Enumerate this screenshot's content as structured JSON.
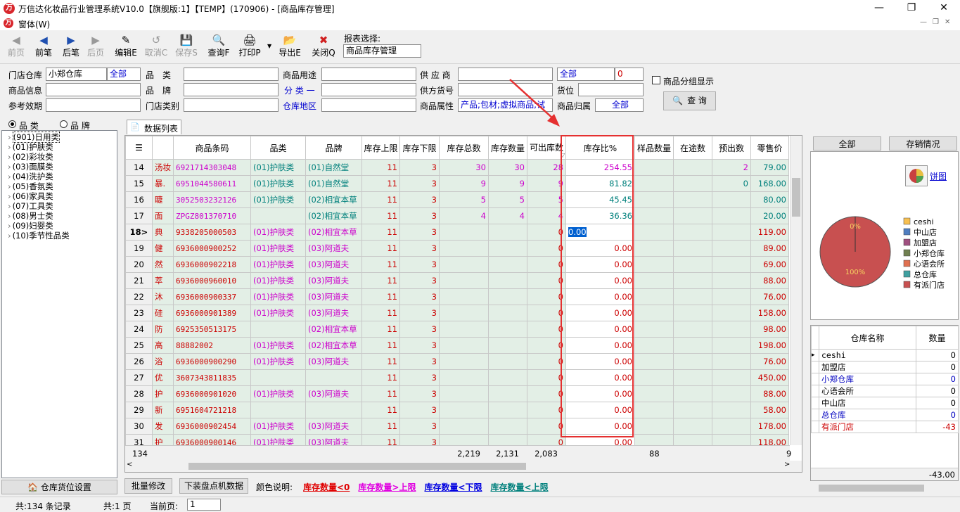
{
  "window": {
    "title": "万信达化妆品行业管理系统V10.0【旗舰版:1】【TEMP】(170906) - [商品库存管理]",
    "menu": "窗体(W)"
  },
  "toolbar": {
    "buttons": [
      {
        "label": "前页",
        "icon": "first-page-icon",
        "enabled": false
      },
      {
        "label": "前笔",
        "icon": "prev-icon",
        "enabled": true
      },
      {
        "label": "后笔",
        "icon": "next-icon",
        "enabled": true
      },
      {
        "label": "后页",
        "icon": "last-page-icon",
        "enabled": false
      },
      {
        "label": "编辑E",
        "icon": "edit-icon",
        "enabled": true
      },
      {
        "label": "取消C",
        "icon": "undo-icon",
        "enabled": false
      },
      {
        "label": "保存S",
        "icon": "save-icon",
        "enabled": false
      },
      {
        "label": "查询F",
        "icon": "query-icon",
        "enabled": true
      },
      {
        "label": "打印P",
        "icon": "print-icon",
        "enabled": true
      },
      {
        "label": "导出E",
        "icon": "export-icon",
        "enabled": true
      },
      {
        "label": "关闭Q",
        "icon": "close-icon",
        "enabled": true
      }
    ],
    "report_label": "报表选择:",
    "report_value": "商品库存管理"
  },
  "filters": {
    "store_label": "门店仓库",
    "store_value": "小郑仓库",
    "store_all": "全部",
    "category_label": "品　类",
    "usage_label": "商品用途",
    "supplier_label": "供 应 商",
    "supplier_all": "全部",
    "supplier_num": "0",
    "group_label": "商品分组显示",
    "goods_info_label": "商品信息",
    "brand_label": "品　牌",
    "class_label": "分 类 一",
    "supplier_code_label": "供方货号",
    "location_label": "货位",
    "expiry_label": "参考效期",
    "store_type_label": "门店类别",
    "area_label": "仓库地区",
    "attr_label": "商品属性",
    "attr_value": "产品;包材;虚拟商品;试",
    "owner_label": "商品归属",
    "owner_value": "全部",
    "query_button": "查 询"
  },
  "tree": {
    "radio1": "品 类",
    "radio2": "品 牌",
    "items": [
      "(901)日用类",
      "(01)护肤类",
      "(02)彩妆类",
      "(03)面膜类",
      "(04)洗护类",
      "(05)香氛类",
      "(06)家具类",
      "(07)工具类",
      "(08)男士类",
      "(09)妇婴类",
      "(10)季节性品类"
    ],
    "bottom_button": "仓库货位设置"
  },
  "grid": {
    "tab": "数据列表",
    "columns": [
      "商品条码",
      "品类",
      "品牌",
      "库存上限",
      "库存下限",
      "库存总数",
      "库存数量",
      "可出库数",
      "库存比%",
      "样品数量",
      "在途数",
      "预出数",
      "零售价"
    ],
    "rows": [
      [
        "14",
        "汤妆",
        "6921714303048",
        "(01)护肤类",
        "(01)自然堂",
        "11",
        "3",
        "30",
        "30",
        "28",
        "254.55",
        "",
        "",
        "2",
        "79.00"
      ],
      [
        "15",
        "暴.",
        "6951044580611",
        "(01)护肤类",
        "(01)自然堂",
        "11",
        "3",
        "9",
        "9",
        "9",
        "81.82",
        "",
        "",
        "0",
        "168.00"
      ],
      [
        "16",
        "睫",
        "3052503232126",
        "(01)护肤类",
        "(02)相宜本草",
        "11",
        "3",
        "5",
        "5",
        "5",
        "45.45",
        "",
        "",
        "",
        "80.00"
      ],
      [
        "17",
        "面",
        "ZPGZ801370710",
        "",
        "(02)相宜本草",
        "11",
        "3",
        "4",
        "4",
        "4",
        "36.36",
        "",
        "",
        "",
        "20.00"
      ],
      [
        "18>",
        "典",
        "9338205000503",
        "(01)护肤类",
        "(02)相宜本草",
        "11",
        "3",
        "",
        "",
        "0",
        "0.00",
        "",
        "",
        "",
        "119.00"
      ],
      [
        "19",
        "健",
        "6936000900252",
        "(01)护肤类",
        "(03)阿道夫",
        "11",
        "3",
        "",
        "",
        "0",
        "0.00",
        "",
        "",
        "",
        "89.00"
      ],
      [
        "20",
        "然",
        "6936000902218",
        "(01)护肤类",
        "(03)阿道夫",
        "11",
        "3",
        "",
        "",
        "0",
        "0.00",
        "",
        "",
        "",
        "69.00"
      ],
      [
        "21",
        "萃",
        "6936000960010",
        "(01)护肤类",
        "(03)阿道夫",
        "11",
        "3",
        "",
        "",
        "0",
        "0.00",
        "",
        "",
        "",
        "88.00"
      ],
      [
        "22",
        "沐",
        "6936000900337",
        "(01)护肤类",
        "(03)阿道夫",
        "11",
        "3",
        "",
        "",
        "0",
        "0.00",
        "",
        "",
        "",
        "76.00"
      ],
      [
        "23",
        "硅",
        "6936000901389",
        "(01)护肤类",
        "(03)阿道夫",
        "11",
        "3",
        "",
        "",
        "0",
        "0.00",
        "",
        "",
        "",
        "158.00"
      ],
      [
        "24",
        "防",
        "6925350513175",
        "",
        "(02)相宜本草",
        "11",
        "3",
        "",
        "",
        "0",
        "0.00",
        "",
        "",
        "",
        "98.00"
      ],
      [
        "25",
        "高",
        "88882002",
        "(01)护肤类",
        "(02)相宜本草",
        "11",
        "3",
        "",
        "",
        "0",
        "0.00",
        "",
        "",
        "",
        "198.00"
      ],
      [
        "26",
        "浴",
        "6936000900290",
        "(01)护肤类",
        "(03)阿道夫",
        "11",
        "3",
        "",
        "",
        "0",
        "0.00",
        "",
        "",
        "",
        "76.00"
      ],
      [
        "27",
        "优",
        "3607343811835",
        "",
        "",
        "11",
        "3",
        "",
        "",
        "0",
        "0.00",
        "",
        "",
        "",
        "450.00"
      ],
      [
        "28",
        "护",
        "6936000901020",
        "(01)护肤类",
        "(03)阿道夫",
        "11",
        "3",
        "",
        "",
        "0",
        "0.00",
        "",
        "",
        "",
        "88.00"
      ],
      [
        "29",
        "新",
        "6951604721218",
        "",
        "",
        "11",
        "3",
        "",
        "",
        "0",
        "0.00",
        "",
        "",
        "",
        "58.00"
      ],
      [
        "30",
        "发",
        "6936000902454",
        "(01)护肤类",
        "(03)阿道夫",
        "11",
        "3",
        "",
        "",
        "0",
        "0.00",
        "",
        "",
        "",
        "178.00"
      ],
      [
        "31",
        "护",
        "6936000900146",
        "(01)护肤类",
        "(03)阿道夫",
        "11",
        "3",
        "",
        "",
        "0",
        "0.00",
        "",
        "",
        "",
        "118.00"
      ]
    ],
    "footer": {
      "count": "134",
      "total": "2,219",
      "qty": "2,131",
      "out": "2,083",
      "sample": "88",
      "tail": "9"
    },
    "edit_cell": "0.00"
  },
  "bottom": {
    "batch_button": "批量修改",
    "download_button": "下装盘点机数据",
    "legend_label": "颜色说明:",
    "legend": [
      {
        "text": "库存数量<0",
        "color": "#e00000"
      },
      {
        "text": "库存数量>上限",
        "color": "#e000e0"
      },
      {
        "text": "库存数量<下限",
        "color": "#0000e0"
      },
      {
        "text": "库存数量<上限",
        "color": "#00807c"
      }
    ]
  },
  "right": {
    "btn_all": "全部",
    "btn_stock": "存销情况",
    "pie_link": "饼图",
    "chart_data": {
      "type": "pie",
      "categories": [
        "ceshi",
        "中山店",
        "加盟店",
        "小郑仓库",
        "心语会所",
        "总仓库",
        "有派门店"
      ],
      "values": [
        0,
        0,
        0,
        0,
        0,
        0,
        100
      ],
      "colors": [
        "#f8c050",
        "#4f7ec0",
        "#a05080",
        "#708050",
        "#e07050",
        "#40a0a0",
        "#c85050"
      ],
      "slice_labels": [
        "0%",
        "100%"
      ]
    },
    "table_headers": [
      "仓库名称",
      "数量"
    ],
    "table_rows": [
      [
        "ceshi",
        "0"
      ],
      [
        "加盟店",
        "0"
      ],
      [
        "小郑仓库",
        "0"
      ],
      [
        "心语会所",
        "0"
      ],
      [
        "中山店",
        "0"
      ],
      [
        "总仓库",
        "0"
      ],
      [
        "有派门店",
        "-43"
      ]
    ],
    "table_total": "-43.00"
  },
  "status": {
    "records": "共:134 条记录",
    "pages": "共:1 页",
    "current_label": "当前页:",
    "current_value": "1"
  }
}
